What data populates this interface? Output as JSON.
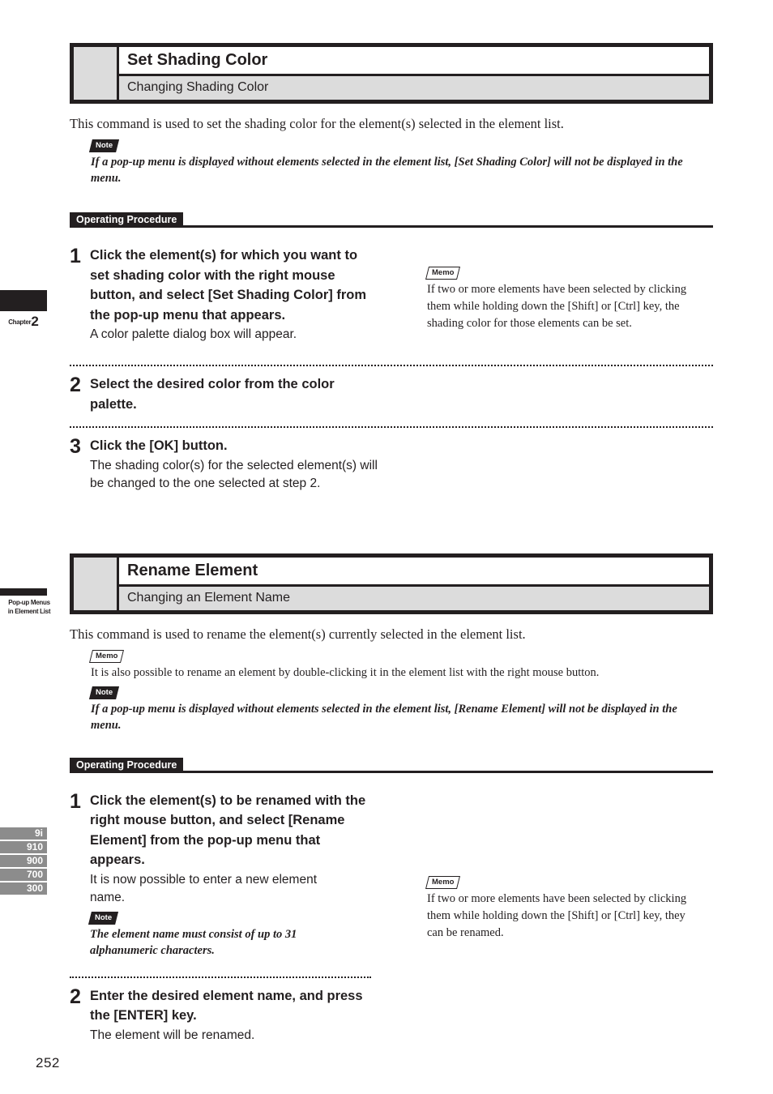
{
  "page": {
    "number": "252",
    "chapter_tab": {
      "word": "Chapter",
      "number": "2"
    },
    "section_tab": {
      "line1": "Pop-up Menus",
      "line2": "in Element List"
    },
    "model_tabs": [
      "9i",
      "910",
      "900",
      "700",
      "300"
    ]
  },
  "badges": {
    "note": "Note",
    "memo": "Memo"
  },
  "labels": {
    "operating_procedure": "Operating Procedure"
  },
  "sections": [
    {
      "title": "Set Shading Color",
      "subtitle": "Changing Shading Color",
      "intro": "This command is used to set the shading color for the element(s) selected in the element list.",
      "note": "If a pop-up menu is displayed without elements selected in the element list, [Set Shading Color] will not be displayed in the menu.",
      "steps": [
        {
          "num": "1",
          "head": "Click the element(s) for which you want to set shading color with the right mouse button, and select [Set Shading Color] from the pop-up menu that appears.",
          "sub": "A color palette dialog box will appear.",
          "memo": "If two or more elements have been selected by clicking them while holding down the [Shift] or [Ctrl] key, the shading color for those elements can be set."
        },
        {
          "num": "2",
          "head": "Select the desired color from the color palette.",
          "sub": ""
        },
        {
          "num": "3",
          "head": "Click the [OK] button.",
          "sub": "The shading color(s) for the selected element(s) will be changed to the one selected at step 2."
        }
      ]
    },
    {
      "title": "Rename Element",
      "subtitle": "Changing an Element Name",
      "intro": "This command is used to rename the element(s) currently selected in the element list.",
      "memo": "It is also possible to rename an element by double-clicking it in the element list with the right mouse button.",
      "note": "If a pop-up menu is displayed without elements selected in the element list, [Rename Element] will not be displayed in the menu.",
      "steps": [
        {
          "num": "1",
          "head": "Click the element(s) to be renamed with the right mouse button, and select [Rename Element] from the pop-up menu that appears.",
          "sub": "It is now possible to enter a new element name.",
          "note": "The element name must consist of up to 31 alphanumeric characters.",
          "memo": "If two or more elements have been selected by clicking them while holding down the [Shift] or [Ctrl] key, they can be renamed."
        },
        {
          "num": "2",
          "head": "Enter the desired element name, and press the [ENTER] key.",
          "sub": "The element will be renamed."
        }
      ]
    }
  ]
}
